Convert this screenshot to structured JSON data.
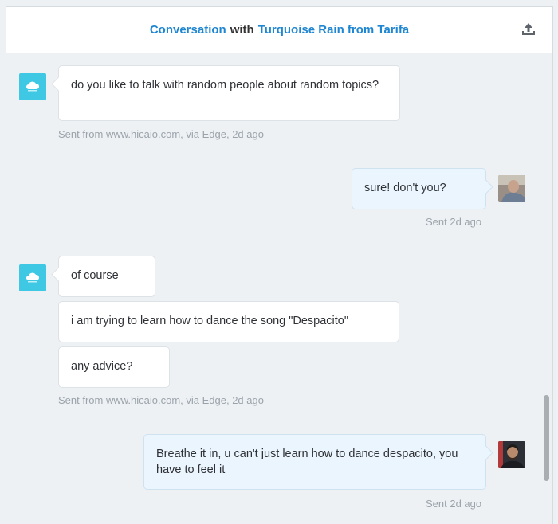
{
  "header": {
    "title_part1": "Conversation",
    "title_part2": "with",
    "title_part3": "Turquoise Rain from Tarifa",
    "export_icon": "upload-icon"
  },
  "messages": [
    {
      "from": "visitor",
      "text": "do you like to talk with random people about random topics?"
    },
    {
      "from": "agent",
      "text": "sure! don't you?"
    },
    {
      "from": "visitor",
      "text": "of course"
    },
    {
      "from": "visitor",
      "text": "i am trying to learn how to dance the song \"Despacito\""
    },
    {
      "from": "visitor",
      "text": "any advice?"
    },
    {
      "from": "agent",
      "text": "Breathe it in, u can't just learn how to dance despacito, you have to feel it"
    }
  ],
  "meta": {
    "visitor_1": "Sent from www.hicaio.com, via Edge, 2d ago",
    "agent_1": "Sent 2d ago",
    "visitor_2": "Sent from www.hicaio.com, via Edge, 2d ago",
    "agent_2": "Sent 2d ago"
  },
  "colors": {
    "accent": "#1f86d1",
    "bot_avatar": "#3fc8e3",
    "agent_bubble": "#eaf5fd"
  }
}
